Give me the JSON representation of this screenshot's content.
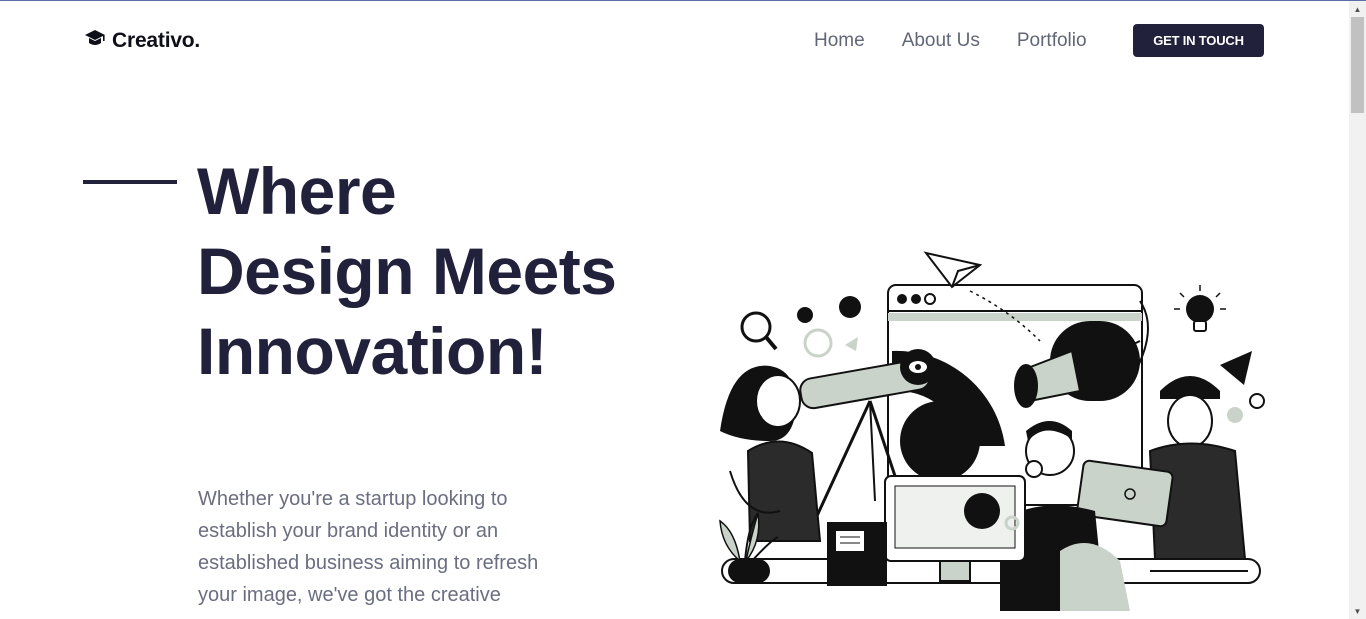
{
  "brand": {
    "name": "Creativo.",
    "logo_icon": "graduation-cap-icon"
  },
  "nav": {
    "items": [
      {
        "label": "Home"
      },
      {
        "label": "About Us"
      },
      {
        "label": "Portfolio"
      }
    ],
    "cta_label": "GET IN TOUCH"
  },
  "hero": {
    "title": "Where Design Meets Innovation!",
    "subtitle": "Whether you're a startup looking to establish your brand identity or an established business aiming to refresh your image, we've got the creative"
  },
  "colors": {
    "primary": "#21213b",
    "text_muted": "#6a6e80",
    "accent_sage": "#c9d3c9",
    "background": "#ffffff"
  }
}
